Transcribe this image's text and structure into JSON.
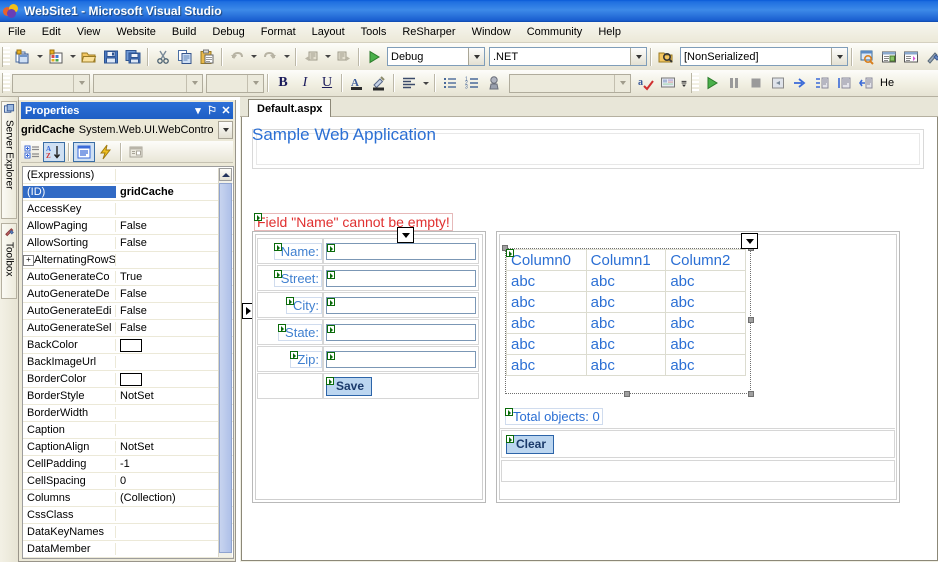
{
  "window": {
    "title": "WebSite1 - Microsoft Visual Studio",
    "app_icon": "visual-studio-icon"
  },
  "menubar": {
    "items": [
      {
        "label": "File"
      },
      {
        "label": "Edit"
      },
      {
        "label": "View"
      },
      {
        "label": "Website"
      },
      {
        "label": "Build"
      },
      {
        "label": "Debug"
      },
      {
        "label": "Format"
      },
      {
        "label": "Layout"
      },
      {
        "label": "Tools"
      },
      {
        "label": "ReSharper"
      },
      {
        "label": "Window"
      },
      {
        "label": "Community"
      },
      {
        "label": "Help"
      }
    ]
  },
  "toolbar_standard": {
    "icons": [
      "new-project-icon",
      "new-website-icon",
      "open-file-icon",
      "save-icon",
      "save-all-icon",
      "cut-icon",
      "copy-icon",
      "paste-icon",
      "undo-icon",
      "redo-icon",
      "navigate-backward-icon",
      "navigate-forward-icon",
      "start-debug-icon"
    ],
    "configuration": {
      "value": "Debug"
    },
    "platform": {
      "value": ".NET"
    },
    "find_combo": {
      "value": "[NonSerialized]",
      "icon": "find-in-files-icon"
    },
    "right_icons": [
      "solution-explorer-icon",
      "properties-window-icon",
      "object-browser-icon",
      "toolbox-icon"
    ]
  },
  "toolbar_formatting": {
    "block_format": {
      "value": ""
    },
    "font_name": {
      "value": ""
    },
    "font_size": {
      "value": ""
    },
    "bold_label": "B",
    "italic_label": "I",
    "underline_label": "U",
    "icons": [
      "foreground-color-icon",
      "background-color-icon",
      "align-left-icon",
      "bullet-list-icon",
      "numbered-list-icon",
      "hyperlink-icon"
    ],
    "style_combo": {
      "value": ""
    },
    "right_icons": [
      "spell-check-icon",
      "style-sheet-icon",
      "start-icon",
      "pause-icon",
      "stop-icon",
      "restart-icon",
      "show-next-statement-icon",
      "step-into-icon",
      "step-over-icon",
      "step-out-icon"
    ],
    "overflow_label": "He"
  },
  "left_dock": {
    "tabs": [
      {
        "label": "Server Explorer",
        "icon": "server-explorer-icon"
      },
      {
        "label": "Toolbox",
        "icon": "toolbox-icon"
      }
    ]
  },
  "properties_panel": {
    "title": "Properties",
    "header_buttons": [
      {
        "name": "dropdown",
        "glyph": "▾"
      },
      {
        "name": "pin",
        "glyph": "⚐"
      },
      {
        "name": "close",
        "glyph": "✕"
      }
    ],
    "object_name": "gridCache",
    "object_type": "System.Web.UI.WebContro",
    "toolbar_icons": [
      "categorized-icon",
      "alphabetical-icon",
      "properties-icon",
      "events-icon",
      "property-pages-icon"
    ],
    "selected_row": "(ID)",
    "rows": [
      {
        "name": "(Expressions)",
        "value": "",
        "expandable": false
      },
      {
        "name": "(ID)",
        "value": "gridCache",
        "expandable": false
      },
      {
        "name": "AccessKey",
        "value": "",
        "expandable": false
      },
      {
        "name": "AllowPaging",
        "value": "False",
        "expandable": false
      },
      {
        "name": "AllowSorting",
        "value": "False",
        "expandable": false
      },
      {
        "name": "AlternatingRowSt",
        "value": "",
        "expandable": true
      },
      {
        "name": "AutoGenerateCo",
        "value": "True",
        "expandable": false
      },
      {
        "name": "AutoGenerateDe",
        "value": "False",
        "expandable": false
      },
      {
        "name": "AutoGenerateEdi",
        "value": "False",
        "expandable": false
      },
      {
        "name": "AutoGenerateSel",
        "value": "False",
        "expandable": false
      },
      {
        "name": "BackColor",
        "value": "",
        "expandable": false,
        "swatch": "#ffffff"
      },
      {
        "name": "BackImageUrl",
        "value": "",
        "expandable": false
      },
      {
        "name": "BorderColor",
        "value": "",
        "expandable": false,
        "swatch": "#ffffff"
      },
      {
        "name": "BorderStyle",
        "value": "NotSet",
        "expandable": false
      },
      {
        "name": "BorderWidth",
        "value": "",
        "expandable": false
      },
      {
        "name": "Caption",
        "value": "",
        "expandable": false
      },
      {
        "name": "CaptionAlign",
        "value": "NotSet",
        "expandable": false
      },
      {
        "name": "CellPadding",
        "value": "-1",
        "expandable": false
      },
      {
        "name": "CellSpacing",
        "value": "0",
        "expandable": false
      },
      {
        "name": "Columns",
        "value": "(Collection)",
        "expandable": false
      },
      {
        "name": "CssClass",
        "value": "",
        "expandable": false
      },
      {
        "name": "DataKeyNames",
        "value": "",
        "expandable": false
      },
      {
        "name": "DataMember",
        "value": "",
        "expandable": false
      }
    ]
  },
  "document": {
    "tab_label": "Default.aspx",
    "page_title": "Sample Web Application",
    "error_message": "Field \"Name\" cannot be empty!",
    "form_rows": [
      {
        "label": "Name:",
        "field_value": ""
      },
      {
        "label": "Street:",
        "field_value": ""
      },
      {
        "label": "City:",
        "field_value": ""
      },
      {
        "label": "State:",
        "field_value": ""
      },
      {
        "label": "Zip:",
        "field_value": ""
      }
    ],
    "save_button": "Save",
    "clear_button": "Clear",
    "total_objects_label": "Total objects: 0",
    "gridview": {
      "headers": [
        "Column0",
        "Column1",
        "Column2"
      ],
      "rows": [
        [
          "abc",
          "abc",
          "abc"
        ],
        [
          "abc",
          "abc",
          "abc"
        ],
        [
          "abc",
          "abc",
          "abc"
        ],
        [
          "abc",
          "abc",
          "abc"
        ],
        [
          "abc",
          "abc",
          "abc"
        ]
      ]
    }
  },
  "colors": {
    "title_bar": "#1f6fe0",
    "accent_blue": "#2b6fd4",
    "error_red": "#e03030",
    "chrome": "#ece9d8",
    "selection": "#316ac5",
    "button_face": "#bcd6f0"
  }
}
